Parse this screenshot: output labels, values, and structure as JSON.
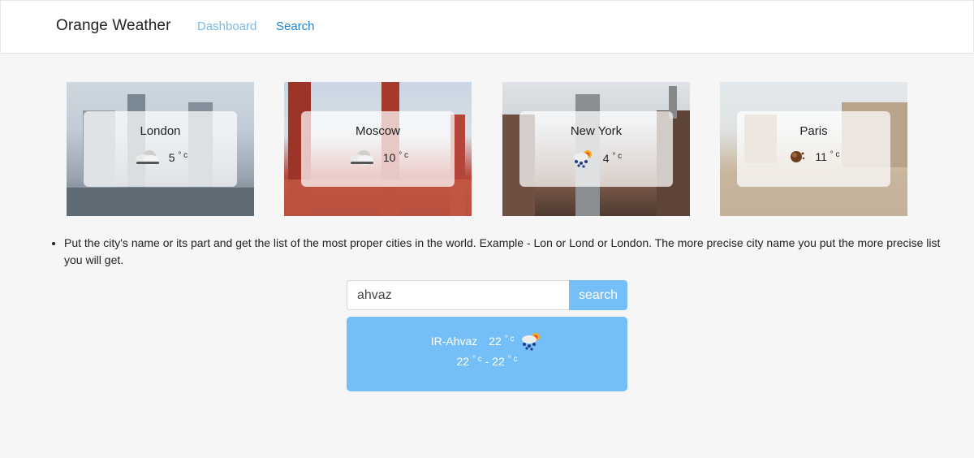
{
  "nav": {
    "brand": "Orange Weather",
    "links": [
      {
        "label": "Dashboard"
      },
      {
        "label": "Search"
      }
    ]
  },
  "cities": [
    {
      "name": "London",
      "temp": "5",
      "unit": "° c",
      "icon": "cloud-icon"
    },
    {
      "name": "Moscow",
      "temp": "10",
      "unit": "° c",
      "icon": "cloud-icon"
    },
    {
      "name": "New York",
      "temp": "4",
      "unit": "° c",
      "icon": "snow-sun-icon"
    },
    {
      "name": "Paris",
      "temp": "11",
      "unit": "° c",
      "icon": "mist-icon"
    }
  ],
  "hint": "Put the city's name or its part and get the list of the most proper cities in the world. Example - Lon or Lond or London. The more precise city name you put the more precise list you will get.",
  "search": {
    "value": "ahvaz",
    "button_label": "search"
  },
  "result": {
    "city": "IR-Ahvaz",
    "temp": "22",
    "unit": "° c",
    "min": "22",
    "max": "22",
    "separator": "-",
    "icon": "snow-sun-icon"
  },
  "colors": {
    "accent": "#74bff8",
    "nav_active": "#1b84d6",
    "nav_inactive": "#7db9e6"
  }
}
